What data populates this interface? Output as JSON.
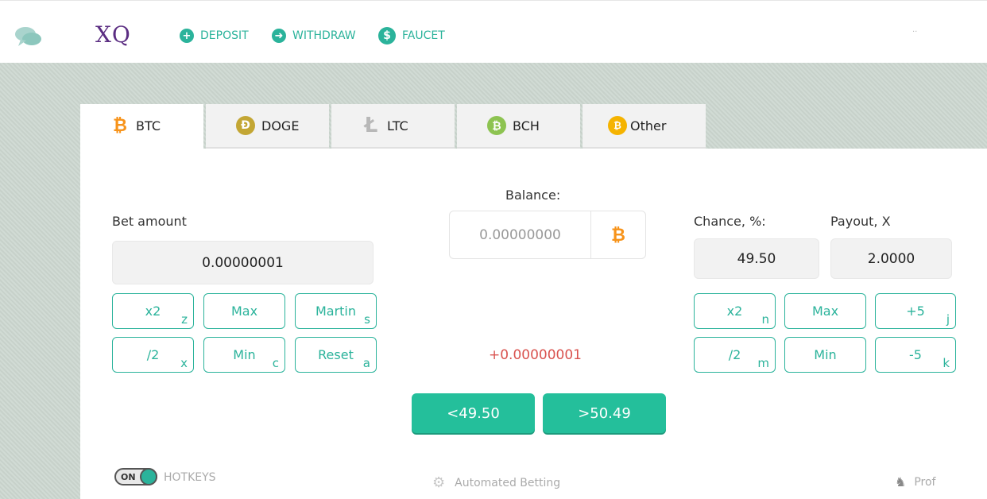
{
  "header": {
    "logo": "XQ",
    "nav": [
      {
        "label": "DEPOSIT",
        "icon": "plus-circle-icon",
        "glyph": "+"
      },
      {
        "label": "WITHDRAW",
        "icon": "arrow-right-circle-icon",
        "glyph": "➜"
      },
      {
        "label": "FAUCET",
        "icon": "dollar-circle-icon",
        "glyph": "$"
      }
    ],
    "dots": "··"
  },
  "tabs": [
    {
      "label": "BTC",
      "icon": "bitcoin-icon",
      "glyph": "₿"
    },
    {
      "label": "DOGE",
      "icon": "dogecoin-icon",
      "glyph": "Ð"
    },
    {
      "label": "LTC",
      "icon": "litecoin-icon",
      "glyph": "Ł"
    },
    {
      "label": "BCH",
      "icon": "bitcoin-cash-icon",
      "glyph": "₿"
    },
    {
      "label": "Other",
      "icon": "other-coin-icon",
      "glyph": "₿"
    }
  ],
  "bet": {
    "label": "Bet amount",
    "value": "0.00000001",
    "buttons": [
      {
        "label": "x2",
        "hotkey": "z"
      },
      {
        "label": "Max",
        "hotkey": ""
      },
      {
        "label": "Martin",
        "hotkey": "s"
      },
      {
        "label": "/2",
        "hotkey": "x"
      },
      {
        "label": "Min",
        "hotkey": "c"
      },
      {
        "label": "Reset",
        "hotkey": "a"
      }
    ]
  },
  "balance": {
    "label": "Balance:",
    "value": "0.00000000",
    "coin_glyph": "₿"
  },
  "profit": "+0.00000001",
  "chance": {
    "label": "Chance, %:",
    "value": "49.50"
  },
  "payout": {
    "label": "Payout, X",
    "value": "2.0000"
  },
  "right_buttons": [
    {
      "label": "x2",
      "hotkey": "n"
    },
    {
      "label": "Max",
      "hotkey": ""
    },
    {
      "label": "+5",
      "hotkey": "j"
    },
    {
      "label": "/2",
      "hotkey": "m"
    },
    {
      "label": "Min",
      "hotkey": ""
    },
    {
      "label": "-5",
      "hotkey": "k"
    }
  ],
  "roll": {
    "low": "<49.50",
    "high": ">50.49"
  },
  "footer": {
    "toggle": "ON",
    "hotkeys": "HOTKEYS",
    "auto": "Automated Betting",
    "prof": "Prof"
  },
  "colors": {
    "accent": "#2bb39b",
    "roll": "#24bf9b",
    "profit": "#d9534f",
    "btc": "#f7931a"
  }
}
